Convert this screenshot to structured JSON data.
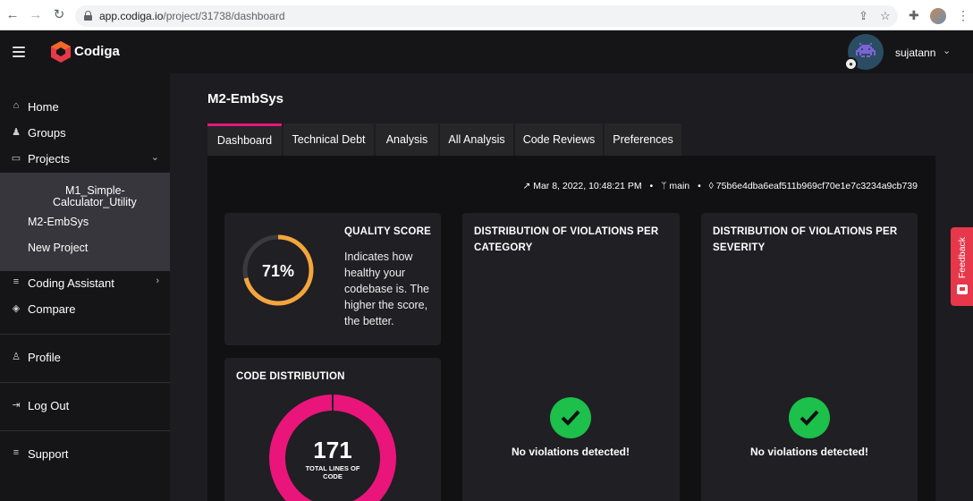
{
  "browser": {
    "url_host": "app.codiga.io",
    "url_path": "/project/31738/dashboard"
  },
  "header": {
    "brand": "Codiga",
    "username": "sujatann"
  },
  "sidebar": {
    "home": "Home",
    "groups": "Groups",
    "projects": "Projects",
    "project_list": [
      "M1_Simple-",
      "Calculator_Utility",
      "M2-EmbSys",
      "New Project"
    ],
    "coding_assistant": "Coding Assistant",
    "compare": "Compare",
    "profile": "Profile",
    "logout": "Log Out",
    "support": "Support"
  },
  "main": {
    "project_title": "M2-EmbSys",
    "tabs": [
      "Dashboard",
      "Technical Debt",
      "Analysis",
      "All Analysis",
      "Code Reviews",
      "Preferences"
    ],
    "active_tab": "Dashboard",
    "meta": {
      "date": "Mar 8, 2022, 10:48:21 PM",
      "branch": "main",
      "commit": "75b6e4dba6eaf511b969cf70e1e7c3234a9cb739"
    }
  },
  "cards": {
    "quality": {
      "title": "QUALITY SCORE",
      "score_text": "71%",
      "score_value": 71,
      "description": "Indicates how healthy your codebase is. The higher the score, the better."
    },
    "category": {
      "title_line1": "DISTRIBUTION OF VIOLATIONS PER",
      "title_line2": "CATEGORY",
      "message": "No violations detected!"
    },
    "severity": {
      "title_line1": "DISTRIBUTION OF VIOLATIONS PER",
      "title_line2": "SEVERITY",
      "message": "No violations detected!"
    },
    "code_distribution": {
      "title": "CODE DISTRIBUTION",
      "total_value": "171",
      "total_label_line1": "TOTAL LINES OF",
      "total_label_line2": "CODE"
    }
  },
  "feedback": {
    "label": "Feedback"
  },
  "colors": {
    "accent_pink": "#e9157a",
    "score_orange": "#f4a53b",
    "success_green": "#1cc04a",
    "feedback_red": "#e6374b"
  }
}
